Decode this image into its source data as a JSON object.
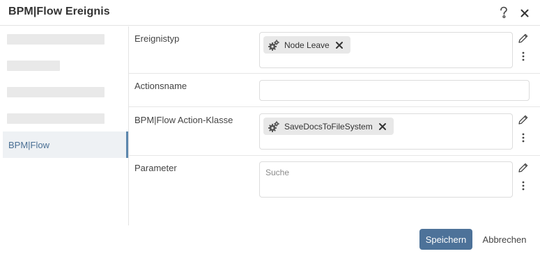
{
  "dialog": {
    "title": "BPM|Flow Ereignis"
  },
  "sidebar": {
    "active_item": "BPM|Flow"
  },
  "form": {
    "ereignistyp": {
      "label": "Ereignistyp",
      "chip": "Node Leave"
    },
    "actionsname": {
      "label": "Actionsname",
      "value": ""
    },
    "action_klasse": {
      "label": "BPM|Flow Action-Klasse",
      "chip": "SaveDocsToFileSystem"
    },
    "parameter": {
      "label": "Parameter",
      "placeholder": "Suche"
    }
  },
  "footer": {
    "save_label": "Speichern",
    "cancel_label": "Abbrechen"
  },
  "colors": {
    "primary": "#4d7299",
    "active_accent": "#5b86ad",
    "active_text": "#4a6f94"
  },
  "icons": {
    "help": "help-icon",
    "close": "close-icon",
    "gear": "gear-icon",
    "remove": "remove-icon",
    "edit": "pencil-icon",
    "more": "more-vertical-icon"
  }
}
